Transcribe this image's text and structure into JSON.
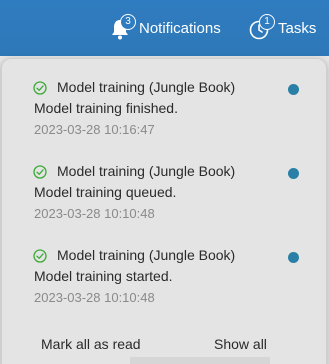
{
  "header": {
    "notifications": {
      "label": "Notifications",
      "count": "3",
      "icon": "bell-icon"
    },
    "tasks": {
      "label": "Tasks",
      "count": "1",
      "icon": "tasks-icon"
    }
  },
  "notifications": {
    "items": [
      {
        "title": "Model training (Jungle Book)",
        "message": "Model training finished.",
        "time": "2023-03-28 10:16:47",
        "status_icon": "check-circle-icon",
        "unread": true
      },
      {
        "title": "Model training (Jungle Book)",
        "message": "Model training queued.",
        "time": "2023-03-28 10:10:48",
        "status_icon": "check-circle-icon",
        "unread": true
      },
      {
        "title": "Model training (Jungle Book)",
        "message": "Model training started.",
        "time": "2023-03-28 10:10:48",
        "status_icon": "check-circle-icon",
        "unread": true
      }
    ],
    "footer": {
      "mark_all_label": "Mark all as read",
      "show_all_label": "Show all"
    }
  },
  "colors": {
    "topbar": "#2f7cc0",
    "success": "#3aaa35",
    "unread_dot": "#2a7fa6",
    "panel_bg": "#e4e4e4"
  }
}
